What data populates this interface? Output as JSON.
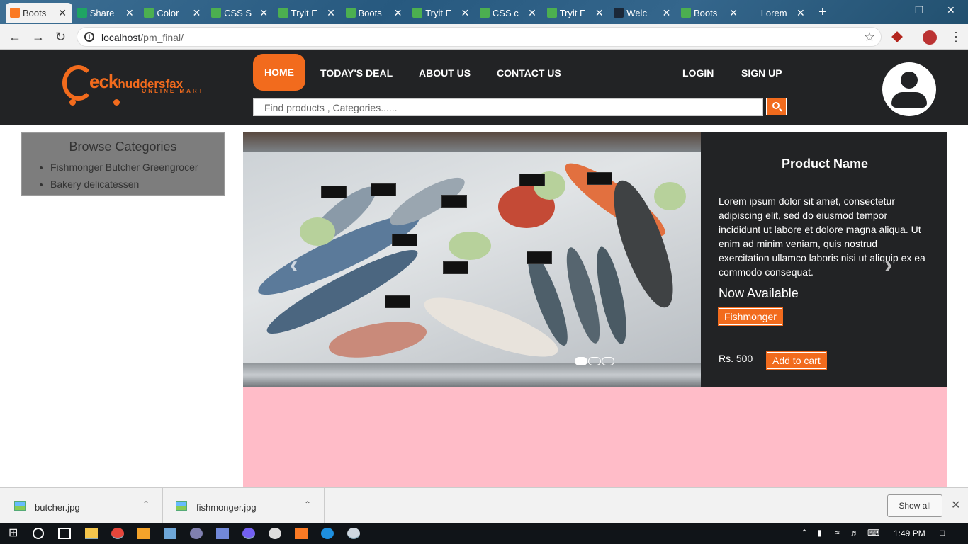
{
  "browser": {
    "tabs": [
      {
        "title": "Boots",
        "icon": "xampp-icon",
        "color": "#fb7a24"
      },
      {
        "title": "Share",
        "icon": "drive-icon",
        "color": "#1fa463"
      },
      {
        "title": "Color",
        "icon": "w3-icon",
        "color": "#4caf50"
      },
      {
        "title": "CSS S",
        "icon": "w3-icon",
        "color": "#4caf50"
      },
      {
        "title": "Tryit E",
        "icon": "w3-icon",
        "color": "#4caf50"
      },
      {
        "title": "Boots",
        "icon": "w3-icon",
        "color": "#4caf50"
      },
      {
        "title": "Tryit E",
        "icon": "w3-icon",
        "color": "#4caf50"
      },
      {
        "title": "CSS c",
        "icon": "w3-icon",
        "color": "#4caf50"
      },
      {
        "title": "Tryit E",
        "icon": "w3-icon",
        "color": "#4caf50"
      },
      {
        "title": "Welc",
        "icon": "steam-icon",
        "color": "#1b2838"
      },
      {
        "title": "Boots",
        "icon": "w3-icon",
        "color": "#4caf50"
      },
      {
        "title": "Lorem",
        "icon": "blank-icon",
        "color": "transparent"
      }
    ],
    "url_host": "localhost",
    "url_path": "/pm_final/"
  },
  "site": {
    "logo": {
      "brand": "eck",
      "brand_rest": "huddersfax",
      "tagline": "ONLINE MART"
    },
    "nav": {
      "home": "HOME",
      "deal": "TODAY'S DEAL",
      "about": "ABOUT US",
      "contact": "CONTACT US",
      "login": "LOGIN",
      "signup": "SIGN UP"
    },
    "search_placeholder": "Find products , Categories......",
    "accent": "#f26b1d",
    "header_bg": "#222325"
  },
  "sidebar": {
    "title": "Browse Categories",
    "items": [
      "Fishmonger Butcher Greengrocer",
      "Bakery delicatessen"
    ]
  },
  "carousel": {
    "product_name": "Product Name",
    "description": "Lorem ipsum dolor sit amet, consectetur adipiscing elit, sed do eiusmod tempor incididunt ut labore et dolore magna aliqua. Ut enim ad minim veniam, quis nostrud exercitation ullamco laboris nisi ut aliquip ex ea commodo consequat.",
    "availability": "Now Available",
    "category": "Fishmonger",
    "price": "Rs. 500",
    "add_to_cart": "Add to cart",
    "slides": 3,
    "active_slide": 1
  },
  "downloads": {
    "files": [
      "butcher.jpg",
      "fishmonger.jpg"
    ],
    "show_all": "Show all"
  },
  "taskbar": {
    "clock": "1:49 PM"
  }
}
